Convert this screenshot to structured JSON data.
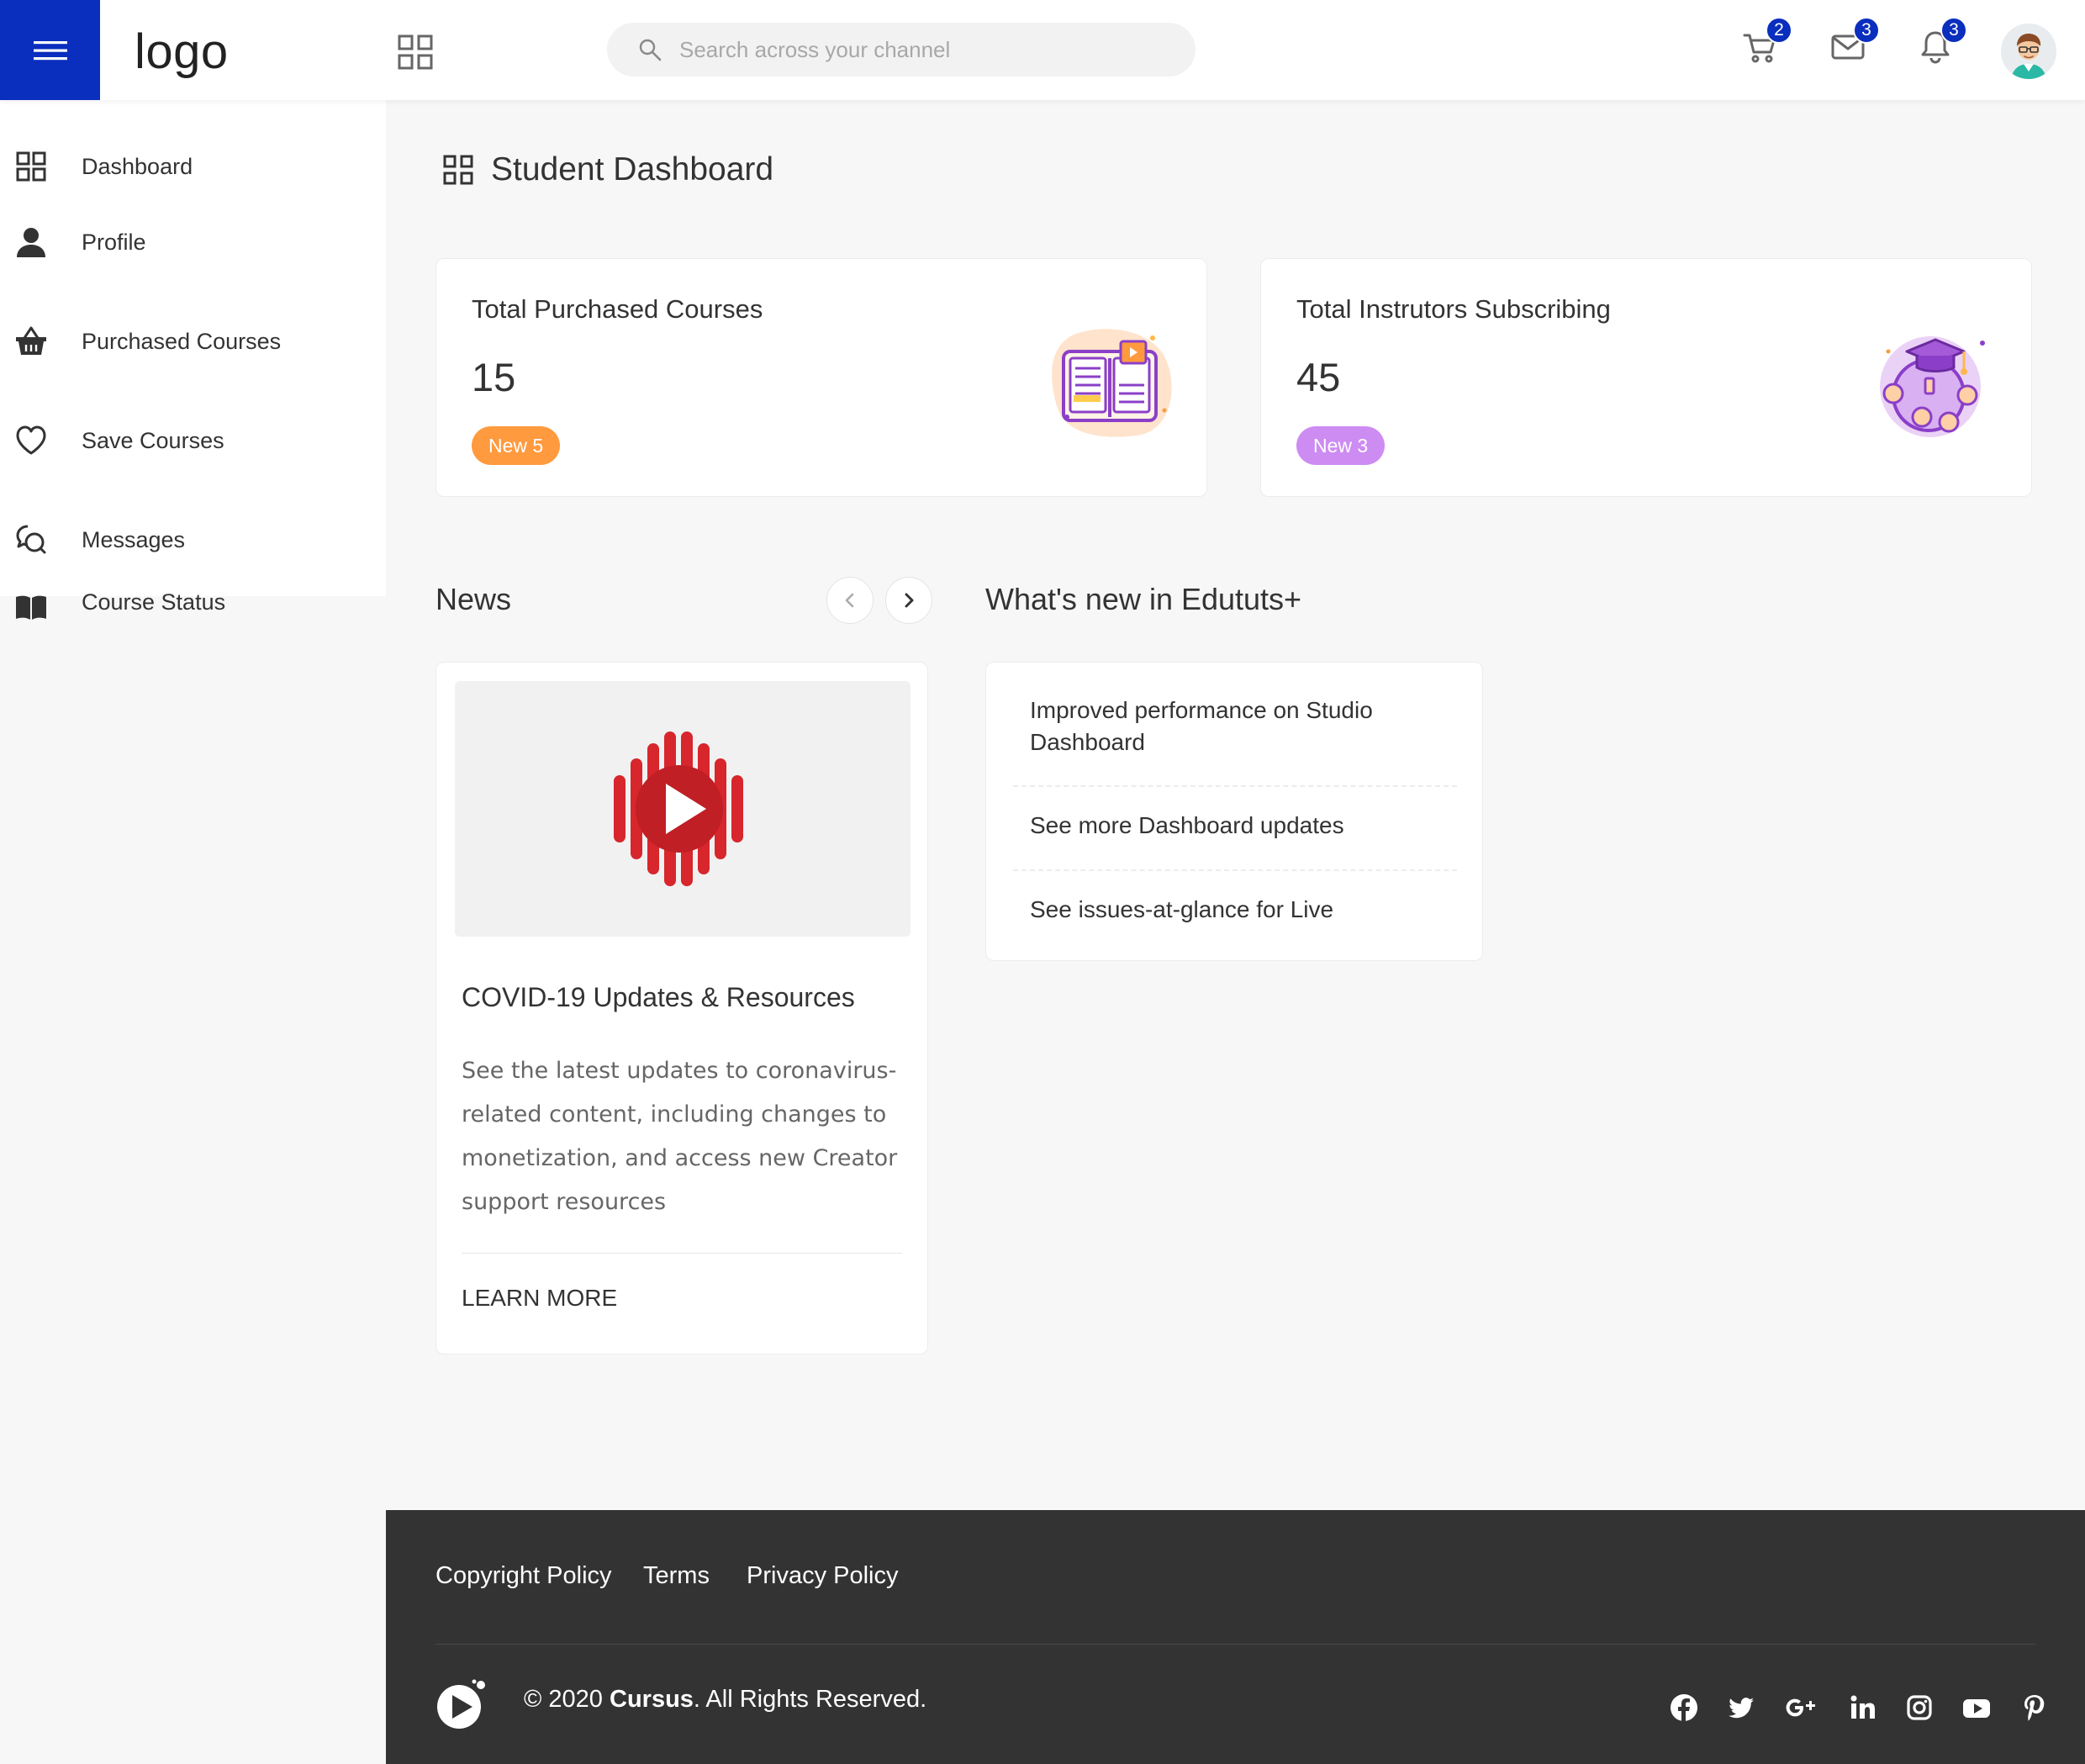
{
  "header": {
    "logo_text": "logo",
    "search_placeholder": "Search across your channel",
    "cart_count": "2",
    "messages_count": "3",
    "notifications_count": "3",
    "accent": "#0a2ebd"
  },
  "sidebar": {
    "items": [
      {
        "label": "Dashboard",
        "icon": "dashboard-grid-icon"
      },
      {
        "label": "Profile",
        "icon": "user-icon"
      },
      {
        "label": "Purchased Courses",
        "icon": "basket-icon"
      },
      {
        "label": "Save Courses",
        "icon": "heart-icon"
      },
      {
        "label": "Messages",
        "icon": "chat-bubbles-icon"
      },
      {
        "label": "Course Status",
        "icon": "open-book-icon"
      }
    ]
  },
  "main": {
    "page_title": "Student Dashboard",
    "stats": [
      {
        "title": "Total Purchased Courses",
        "value": "15",
        "badge": "New 5",
        "badge_color": "#ff9a3e"
      },
      {
        "title": "Total Instrutors Subscribing",
        "value": "45",
        "badge": "New 3",
        "badge_color": "#cd8cf2"
      }
    ],
    "news": {
      "section_title": "News",
      "title": "COVID-19 Updates & Resources",
      "description": "See the latest updates to coronavirus-related content, including changes to monetization, and access new Creator support resources",
      "link_label": "LEARN MORE"
    },
    "whats_new": {
      "section_title": "What's new in Edututs+",
      "items": [
        "Improved performance on Studio Dashboard",
        "See more Dashboard updates",
        "See issues-at-glance for Live"
      ]
    }
  },
  "footer": {
    "links": [
      "Copyright Policy",
      "Terms",
      "Privacy Policy"
    ],
    "copyright_prefix": "© 2020 ",
    "brand": "Cursus",
    "copyright_suffix": ". All Rights Reserved.",
    "socials": [
      "facebook-icon",
      "twitter-icon",
      "google-plus-icon",
      "linkedin-icon",
      "instagram-icon",
      "youtube-icon",
      "pinterest-icon"
    ]
  }
}
